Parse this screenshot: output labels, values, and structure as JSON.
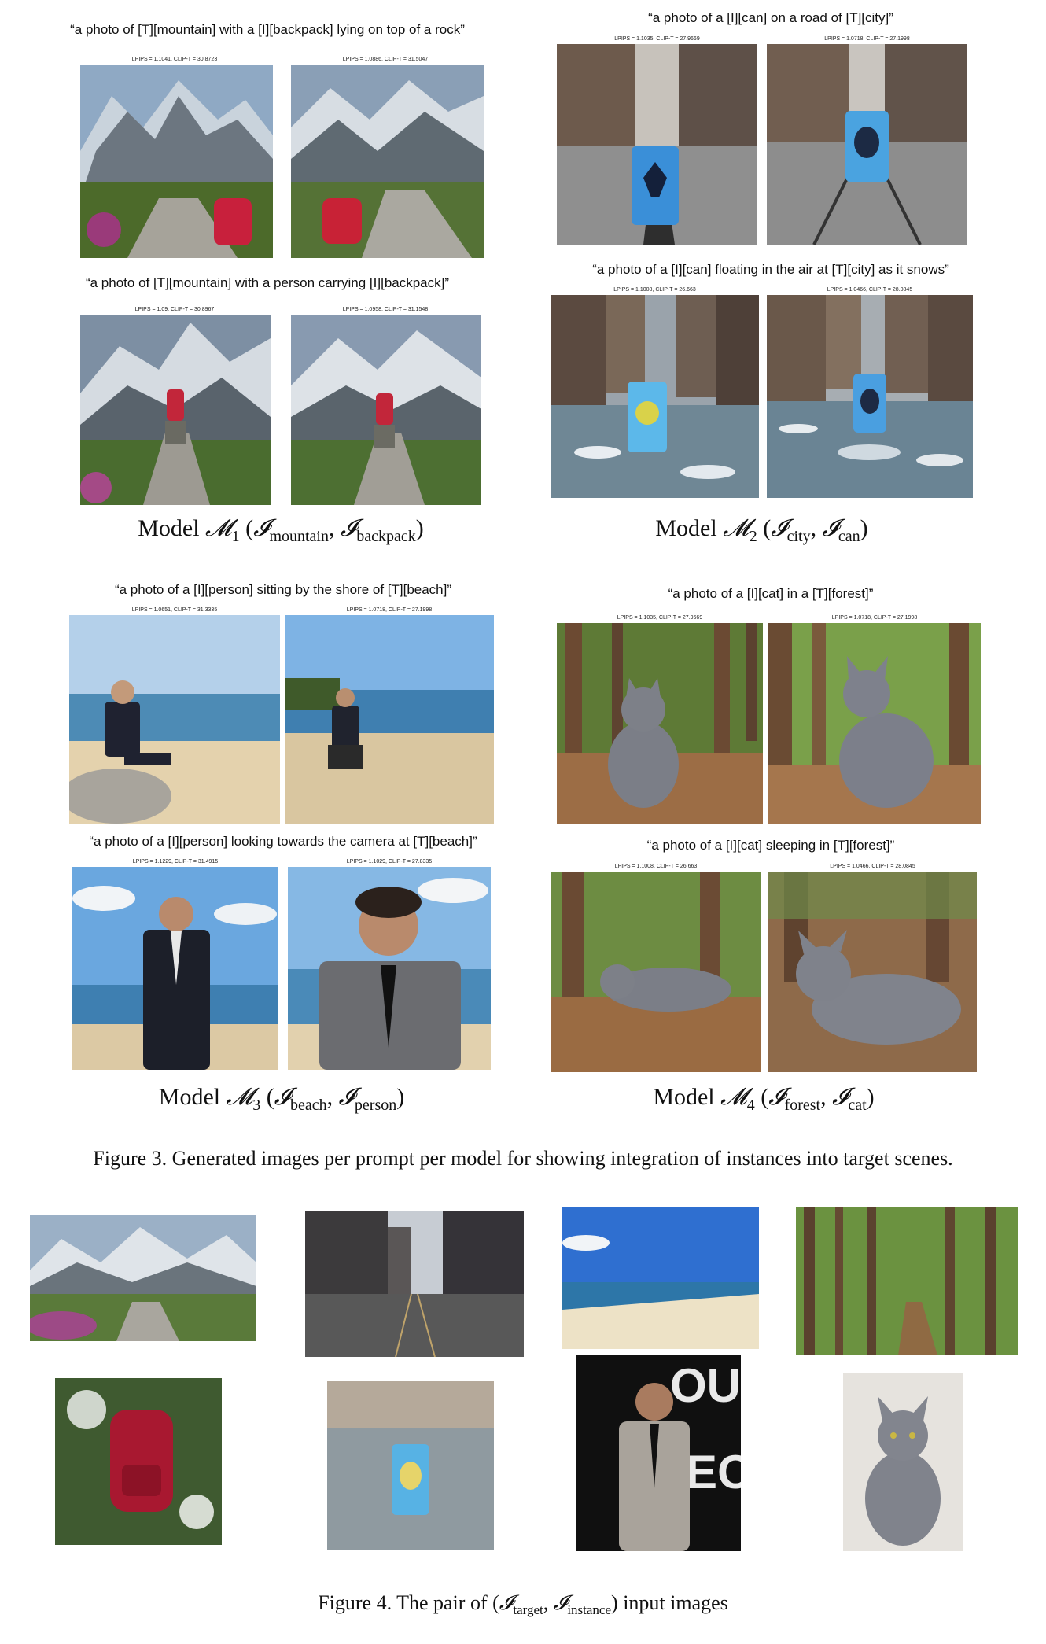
{
  "panels": {
    "m1": {
      "rows": [
        {
          "prompt": "“a photo of [T][mountain] with a [I][backpack] lying on top of a rock”",
          "metrics": [
            "LPIPS = 1.1041, CLIP-T = 30.8723",
            "LPIPS = 1.0886, CLIP-T = 31.5047"
          ]
        },
        {
          "prompt": "“a photo of [T][mountain] with a person carrying [I][backpack]”",
          "metrics": [
            "LPIPS = 1.09, CLIP-T = 30.8967",
            "LPIPS = 1.0958, CLIP-T = 31.1548"
          ]
        }
      ],
      "caption": {
        "prefix": "Model ",
        "sym": "𝓜",
        "idx": "1",
        "open": " (",
        "a_sym": "𝓘",
        "a_sub": "mountain",
        "sep": ", ",
        "b_sym": "𝓘",
        "b_sub": "backpack",
        "close": ")"
      }
    },
    "m2": {
      "rows": [
        {
          "prompt": "“a photo of a [I][can] on a road of [T][city]”",
          "metrics": [
            "LPIPS = 1.1035, CLIP-T = 27.9669",
            "LPIPS = 1.0718, CLIP-T = 27.1998"
          ]
        },
        {
          "prompt": "“a photo of a [I][can] floating in the air at [T][city] as it snows”",
          "metrics": [
            "LPIPS = 1.1008, CLIP-T = 26.663",
            "LPIPS = 1.0466, CLIP-T = 28.0845"
          ]
        }
      ],
      "caption": {
        "prefix": "Model ",
        "sym": "𝓜",
        "idx": "2",
        "open": " (",
        "a_sym": "𝓘",
        "a_sub": "city",
        "sep": ", ",
        "b_sym": "𝓘",
        "b_sub": "can",
        "close": ")"
      }
    },
    "m3": {
      "rows": [
        {
          "prompt": "“a photo of a [I][person] sitting by the shore of [T][beach]”",
          "metrics": [
            "LPIPS = 1.0651, CLIP-T = 31.3335",
            "LPIPS = 1.0718, CLIP-T = 27.1998"
          ]
        },
        {
          "prompt": "“a photo of a [I][person] looking towards the camera at [T][beach]”",
          "metrics": [
            "LPIPS = 1.1229, CLIP-T = 31.4915",
            "LPIPS = 1.1029, CLIP-T = 27.8335"
          ]
        }
      ],
      "caption": {
        "prefix": "Model ",
        "sym": "𝓜",
        "idx": "3",
        "open": " (",
        "a_sym": "𝓘",
        "a_sub": "beach",
        "sep": ", ",
        "b_sym": "𝓘",
        "b_sub": "person",
        "close": ")"
      }
    },
    "m4": {
      "rows": [
        {
          "prompt": "“a photo of a [I][cat] in a [T][forest]”",
          "metrics": [
            "LPIPS = 1.1035, CLIP-T = 27.9669",
            "LPIPS = 1.0718, CLIP-T = 27.1998"
          ]
        },
        {
          "prompt": "“a photo of a [I][cat] sleeping in [T][forest]”",
          "metrics": [
            "LPIPS = 1.1008, CLIP-T = 26.663",
            "LPIPS = 1.0466, CLIP-T = 28.0845"
          ]
        }
      ],
      "caption": {
        "prefix": "Model ",
        "sym": "𝓜",
        "idx": "4",
        "open": " (",
        "a_sym": "𝓘",
        "a_sub": "forest",
        "sep": ", ",
        "b_sym": "𝓘",
        "b_sub": "cat",
        "close": ")"
      }
    }
  },
  "figure3_caption": "Figure 3. Generated images per prompt per model for showing integration of instances into target scenes.",
  "figure4_caption": {
    "prefix": "Figure 4. The pair of (",
    "a_sym": "𝓘",
    "a_sub": "target",
    "sep": ", ",
    "b_sym": "𝓘",
    "b_sub": "instance",
    "suffix": ") input images"
  },
  "colors": {
    "sky": "#9fc3e6",
    "forest": "#4f6b2c",
    "sand": "#e6d3ae",
    "sea": "#3f7fb0",
    "can": "#4aa3e0",
    "backpack": "#b0182f",
    "suit": "#1e2230",
    "cat": "#7d8088",
    "road": "#555555"
  }
}
